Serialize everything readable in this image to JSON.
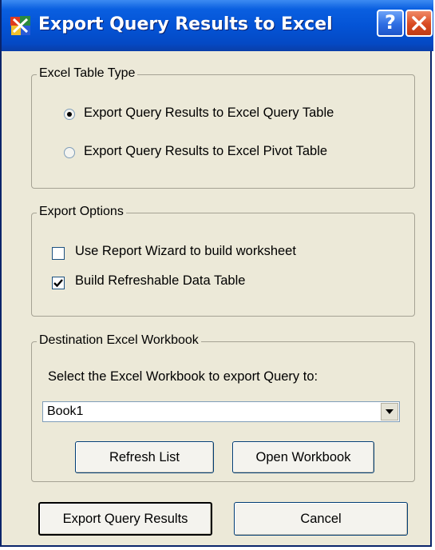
{
  "window": {
    "title": "Export Query Results to Excel",
    "help_label": "?",
    "close_label": "✕"
  },
  "table_type": {
    "legend": "Excel Table Type",
    "options": [
      {
        "label": "Export Query Results to Excel Query Table",
        "checked": true
      },
      {
        "label": "Export Query Results to Excel Pivot Table",
        "checked": false
      }
    ]
  },
  "export_options": {
    "legend": "Export Options",
    "options": [
      {
        "label": "Use Report Wizard to build worksheet",
        "checked": false
      },
      {
        "label": "Build Refreshable Data Table",
        "checked": true
      }
    ]
  },
  "destination": {
    "legend": "Destination Excel Workbook",
    "prompt": "Select the Excel Workbook to export Query to:",
    "workbook_value": "Book1",
    "refresh_label": "Refresh List",
    "open_label": "Open Workbook"
  },
  "footer": {
    "export_label": "Export Query Results",
    "cancel_label": "Cancel"
  }
}
